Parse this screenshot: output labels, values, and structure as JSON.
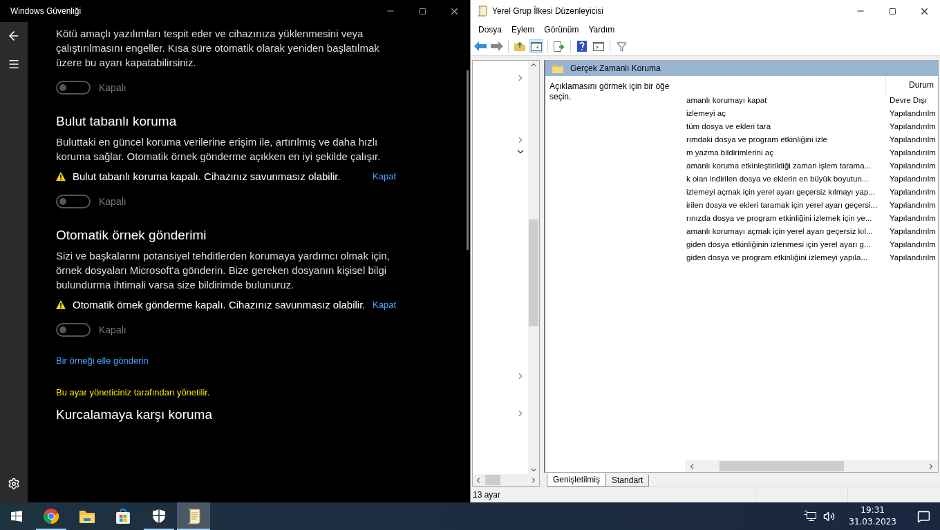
{
  "security_window": {
    "title": "Windows Güvenliği",
    "sections": [
      {
        "description": "Kötü amaçlı yazılımları tespit eder ve cihazınıza yüklenmesini veya çalıştırılmasını engeller. Kısa süre otomatik olarak yeniden başlatılmak üzere bu ayarı kapatabilirsiniz.",
        "toggle": {
          "on": false,
          "label": "Kapalı"
        }
      },
      {
        "heading": "Bulut tabanlı koruma",
        "description": "Buluttaki en güncel koruma verilerine erişim ile, artırılmış ve daha hızlı koruma sağlar. Otomatik örnek gönderme açıkken en iyi şekilde çalışır.",
        "warning": {
          "text": "Bulut tabanlı koruma kapalı. Cihazınız savunmasız olabilir.",
          "link": "Kapat"
        },
        "toggle": {
          "on": false,
          "label": "Kapalı"
        }
      },
      {
        "heading": "Otomatik örnek gönderimi",
        "description": "Sizi ve başkalarını potansiyel tehditlerden korumaya yardımcı olmak için, örnek dosyaları Microsoft'a gönderin. Bize gereken dosyanın kişisel bilgi bulundurma ihtimali varsa size bildirimde bulunuruz.",
        "warning": {
          "text": "Otomatik örnek gönderme kapalı. Cihazınız savunmasız olabilir.",
          "link": "Kapat"
        },
        "toggle": {
          "on": false,
          "label": "Kapalı"
        },
        "link": "Bir örneği elle gönderin"
      },
      {
        "note": "Bu ayar yöneticiniz tarafından yönetilir.",
        "heading": "Kurcalamaya karşı koruma"
      }
    ]
  },
  "editor_window": {
    "title": "Yerel Grup İlkesi Düzenleyicisi",
    "menu": [
      "Dosya",
      "Eylem",
      "Görünüm",
      "Yardım"
    ],
    "tree_nodes": [
      {
        "expanded": false
      },
      {
        "expanded": false
      },
      {
        "expanded": true
      },
      {
        "expanded": false
      },
      {
        "expanded": false
      }
    ],
    "folder_title": "Gerçek Zamanlı Koruma",
    "description": "Açıklamasını görmek için bir öğe seçin.",
    "columns": [
      "Durum"
    ],
    "rows": [
      {
        "setting": "amanlı korumayı kapat",
        "state": "Devre Dışı"
      },
      {
        "setting": "izlemeyi aç",
        "state": "Yapılandırılm"
      },
      {
        "setting": "tüm dosya ve ekleri tara",
        "state": "Yapılandırılm"
      },
      {
        "setting": "rımdaki dosya ve program etkinliğini izle",
        "state": "Yapılandırılm"
      },
      {
        "setting": "m yazma bildirimlerini aç",
        "state": "Yapılandırılm"
      },
      {
        "setting": "amanlı koruma etkinleştirildiği zaman işlem tarama...",
        "state": "Yapılandırılm"
      },
      {
        "setting": "k olan indirilen dosya ve eklerin en büyük boyutun...",
        "state": "Yapılandırılm"
      },
      {
        "setting": "izlemeyi açmak için yerel ayarı geçersiz kılmayı yap...",
        "state": "Yapılandırılm"
      },
      {
        "setting": "irilen dosya ve ekleri taramak için yerel ayarı geçersi...",
        "state": "Yapılandırılm"
      },
      {
        "setting": "rınızda dosya ve program etkinliğini izlemek için ye...",
        "state": "Yapılandırılm"
      },
      {
        "setting": "amanlı korumayı açmak için yerel ayarı geçersiz kıl...",
        "state": "Yapılandırılm"
      },
      {
        "setting": "giden dosya etkinliğinin izlenmesi için yerel ayarı g...",
        "state": "Yapılandırılm"
      },
      {
        "setting": "giden dosya ve program etkinliğini izlemeyi yapıla...",
        "state": "Yapılandırılm"
      }
    ],
    "tabs": [
      {
        "label": "Genişletilmiş",
        "selected": true
      },
      {
        "label": "Standart",
        "selected": false
      }
    ],
    "status": "13 ayar"
  },
  "taskbar": {
    "apps": [
      {
        "kind": "browser",
        "running": true,
        "selected": false
      },
      {
        "kind": "explorer",
        "running": false,
        "selected": false
      },
      {
        "kind": "store",
        "running": false,
        "selected": false
      },
      {
        "kind": "security",
        "running": true,
        "selected": false
      },
      {
        "kind": "policy",
        "running": true,
        "selected": true
      }
    ],
    "time": "19:31",
    "date": "31.03.2023"
  }
}
